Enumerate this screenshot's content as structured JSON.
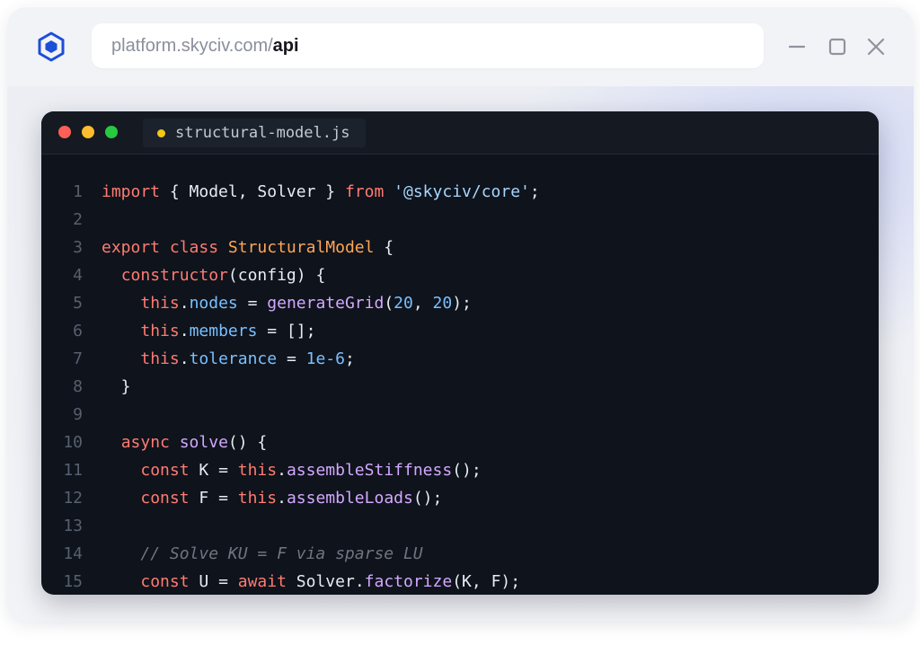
{
  "colors": {
    "accent": "#1d4ed8",
    "traffic_red": "#ff5f57",
    "traffic_yellow": "#febc2e",
    "traffic_green": "#28c840",
    "tab_modified_dot": "#f5c518"
  },
  "app": {
    "logo_icon": "hexagon-logo-icon"
  },
  "address_bar": {
    "base": "platform.skyciv.com/",
    "path": "api"
  },
  "window_controls": {
    "minimize_icon": "minimize-icon",
    "maximize_icon": "maximize-icon",
    "close_icon": "close-icon"
  },
  "editor": {
    "tab": {
      "filename": "structural-model.js",
      "modified_indicator": "dot-icon"
    },
    "lines": [
      {
        "n": "1",
        "tokens": [
          [
            "kw",
            "import"
          ],
          [
            "p",
            " { "
          ],
          [
            "id",
            "Model"
          ],
          [
            "p",
            ", "
          ],
          [
            "id",
            "Solver"
          ],
          [
            "p",
            " } "
          ],
          [
            "kw",
            "from"
          ],
          [
            "p",
            " "
          ],
          [
            "str",
            "'@skyciv/core'"
          ],
          [
            "p",
            ";"
          ]
        ]
      },
      {
        "n": "2",
        "tokens": []
      },
      {
        "n": "3",
        "tokens": [
          [
            "kw",
            "export"
          ],
          [
            "p",
            " "
          ],
          [
            "kw",
            "class"
          ],
          [
            "p",
            " "
          ],
          [
            "cls",
            "StructuralModel"
          ],
          [
            "p",
            " {"
          ]
        ]
      },
      {
        "n": "4",
        "tokens": [
          [
            "p",
            "  "
          ],
          [
            "kw",
            "constructor"
          ],
          [
            "p",
            "("
          ],
          [
            "id",
            "config"
          ],
          [
            "p",
            ") {"
          ]
        ]
      },
      {
        "n": "5",
        "tokens": [
          [
            "p",
            "    "
          ],
          [
            "kw",
            "this"
          ],
          [
            "p",
            "."
          ],
          [
            "prop",
            "nodes"
          ],
          [
            "p",
            " = "
          ],
          [
            "fn",
            "generateGrid"
          ],
          [
            "p",
            "("
          ],
          [
            "num",
            "20"
          ],
          [
            "p",
            ", "
          ],
          [
            "num",
            "20"
          ],
          [
            "p",
            ");"
          ]
        ]
      },
      {
        "n": "6",
        "tokens": [
          [
            "p",
            "    "
          ],
          [
            "kw",
            "this"
          ],
          [
            "p",
            "."
          ],
          [
            "prop",
            "members"
          ],
          [
            "p",
            " = [];"
          ]
        ]
      },
      {
        "n": "7",
        "tokens": [
          [
            "p",
            "    "
          ],
          [
            "kw",
            "this"
          ],
          [
            "p",
            "."
          ],
          [
            "prop",
            "tolerance"
          ],
          [
            "p",
            " = "
          ],
          [
            "num",
            "1e-6"
          ],
          [
            "p",
            ";"
          ]
        ]
      },
      {
        "n": "8",
        "tokens": [
          [
            "p",
            "  }"
          ]
        ]
      },
      {
        "n": "9",
        "tokens": []
      },
      {
        "n": "10",
        "tokens": [
          [
            "p",
            "  "
          ],
          [
            "kw",
            "async"
          ],
          [
            "p",
            " "
          ],
          [
            "fn",
            "solve"
          ],
          [
            "p",
            "() {"
          ]
        ]
      },
      {
        "n": "11",
        "tokens": [
          [
            "p",
            "    "
          ],
          [
            "kw",
            "const"
          ],
          [
            "p",
            " "
          ],
          [
            "id",
            "K"
          ],
          [
            "p",
            " = "
          ],
          [
            "kw",
            "this"
          ],
          [
            "p",
            "."
          ],
          [
            "fn",
            "assembleStiffness"
          ],
          [
            "p",
            "();"
          ]
        ]
      },
      {
        "n": "12",
        "tokens": [
          [
            "p",
            "    "
          ],
          [
            "kw",
            "const"
          ],
          [
            "p",
            " "
          ],
          [
            "id",
            "F"
          ],
          [
            "p",
            " = "
          ],
          [
            "kw",
            "this"
          ],
          [
            "p",
            "."
          ],
          [
            "fn",
            "assembleLoads"
          ],
          [
            "p",
            "();"
          ]
        ]
      },
      {
        "n": "13",
        "tokens": []
      },
      {
        "n": "14",
        "tokens": [
          [
            "p",
            "    "
          ],
          [
            "cmt",
            "// Solve KU = F via sparse LU"
          ]
        ]
      },
      {
        "n": "15",
        "tokens": [
          [
            "p",
            "    "
          ],
          [
            "kw",
            "const"
          ],
          [
            "p",
            " "
          ],
          [
            "id",
            "U"
          ],
          [
            "p",
            " = "
          ],
          [
            "kw",
            "await"
          ],
          [
            "p",
            " "
          ],
          [
            "id",
            "Solver"
          ],
          [
            "p",
            "."
          ],
          [
            "fn",
            "factorize"
          ],
          [
            "p",
            "("
          ],
          [
            "id",
            "K"
          ],
          [
            "p",
            ", "
          ],
          [
            "id",
            "F"
          ],
          [
            "p",
            ");"
          ]
        ]
      }
    ]
  }
}
